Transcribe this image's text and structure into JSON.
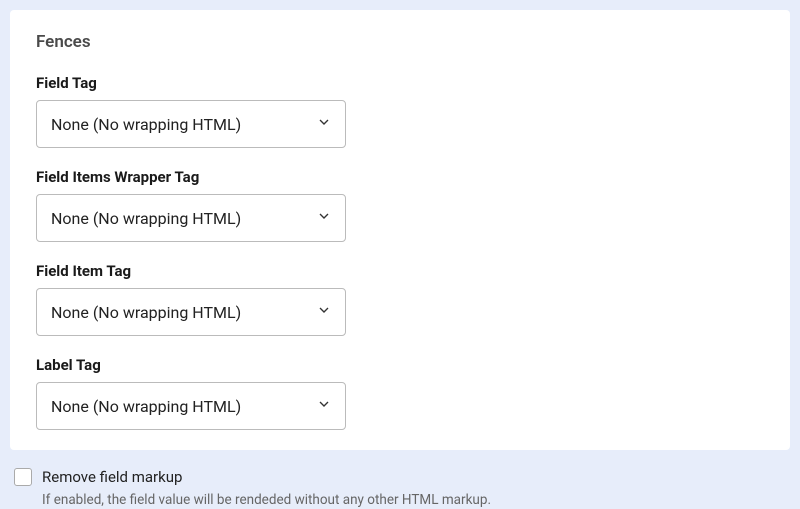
{
  "panel": {
    "title": "Fences",
    "fields": [
      {
        "label": "Field Tag",
        "value": "None (No wrapping HTML)"
      },
      {
        "label": "Field Items Wrapper Tag",
        "value": "None (No wrapping HTML)"
      },
      {
        "label": "Field Item Tag",
        "value": "None (No wrapping HTML)"
      },
      {
        "label": "Label Tag",
        "value": "None (No wrapping HTML)"
      }
    ]
  },
  "option": {
    "label": "Remove field markup",
    "help": "If enabled, the field value will be rendeded without any other HTML markup."
  }
}
